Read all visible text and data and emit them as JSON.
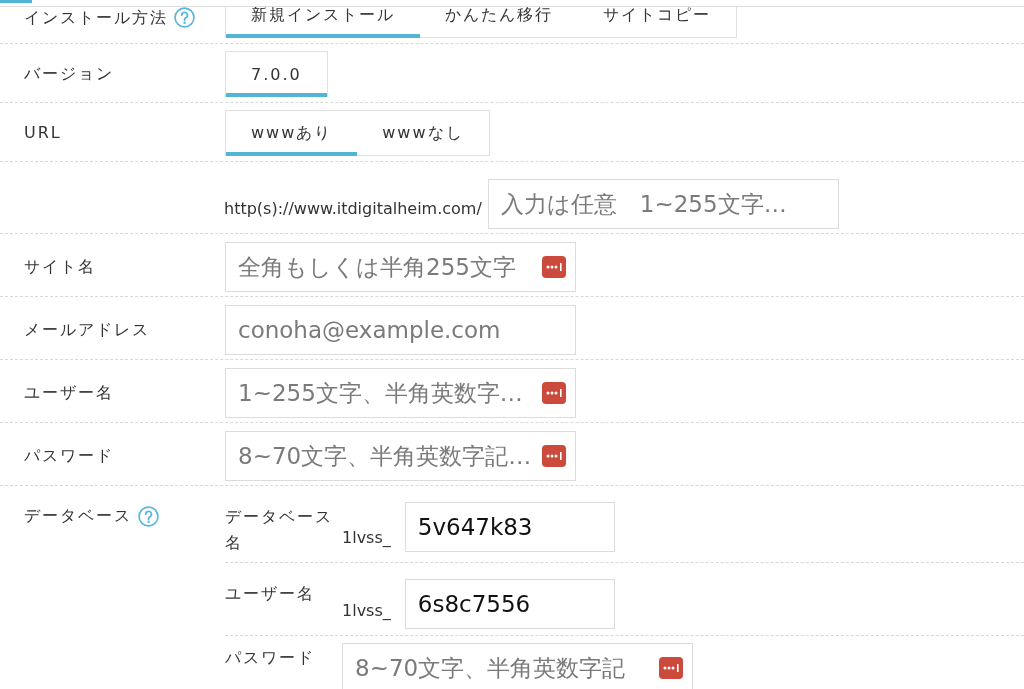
{
  "form": {
    "rows": [
      {
        "kind": "tabs",
        "label": "インストール方法",
        "help": true,
        "tabs": [
          {
            "label": "新規インストール",
            "selected": true
          },
          {
            "label": "かんたん移行",
            "selected": false
          },
          {
            "label": "サイトコピー",
            "selected": false
          }
        ]
      },
      {
        "kind": "tabs",
        "label": "バージョン",
        "tabs": [
          {
            "label": "7.0.0",
            "selected": true
          }
        ]
      },
      {
        "kind": "tabs",
        "label": "URL",
        "tabs": [
          {
            "label": "wwwあり",
            "selected": true
          },
          {
            "label": "wwwなし",
            "selected": false
          }
        ]
      },
      {
        "kind": "path",
        "prefix": "http(s)://www.itdigitalheim.com/",
        "field": {
          "placeholder": "入力は任意　1~255文字…"
        }
      },
      {
        "kind": "field",
        "label": "サイト名",
        "field": {
          "placeholder": "全角もしくは半角255文字",
          "autofill_icon": true
        }
      },
      {
        "kind": "field",
        "label": "メールアドレス",
        "field": {
          "placeholder": "conoha@example.com"
        }
      },
      {
        "kind": "field",
        "label": "ユーザー名",
        "field": {
          "placeholder": "1~255文字、半角英数字…",
          "autofill_icon": true
        }
      },
      {
        "kind": "field",
        "label": "パスワード",
        "field": {
          "placeholder": "8~70文字、半角英数字記…",
          "autofill_icon": true
        }
      },
      {
        "kind": "group",
        "label": "データベース",
        "help": true,
        "subrows": [
          {
            "label": "データベース名",
            "prefix": "1lvss_",
            "field": {
              "value": "5v647k83"
            }
          },
          {
            "label": "ユーザー名",
            "prefix": "1lvss_",
            "field": {
              "value": "6s8c7556"
            }
          },
          {
            "label": "パスワード",
            "field": {
              "placeholder": "8~70文字、半角英数字記",
              "autofill_icon": true
            }
          }
        ]
      }
    ]
  }
}
